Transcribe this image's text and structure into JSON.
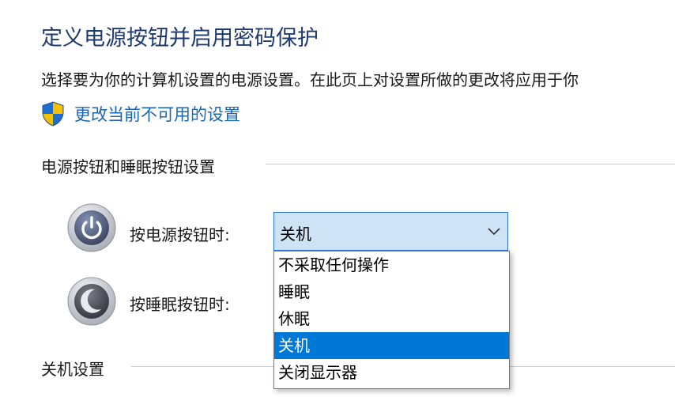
{
  "header": {
    "title": "定义电源按钮并启用密码保护",
    "description": "选择要为你的计算机设置的电源设置。在此页上对设置所做的更改将应用于你"
  },
  "change_settings_link": {
    "label": "更改当前不可用的设置",
    "icon": "uac-shield-icon",
    "shield_colors": [
      "#1e6fd0",
      "#f2c200"
    ]
  },
  "power_section": {
    "heading": "电源按钮和睡眠按钮设置",
    "power_button": {
      "label": "按电源按钮时:",
      "icon": "power-button-icon",
      "selected": "关机",
      "options": [
        "不采取任何操作",
        "睡眠",
        "休眠",
        "关机",
        "关闭显示器"
      ],
      "dropdown_open": true
    },
    "sleep_button": {
      "label": "按睡眠按钮时:",
      "icon": "sleep-button-icon"
    }
  },
  "shutdown_section": {
    "heading": "关机设置"
  },
  "colors": {
    "title": "#1e3b70",
    "link": "#1b66b5",
    "select_background": "#cfe3f6",
    "select_border": "#2a74d4",
    "option_highlight": "#0078d7"
  }
}
